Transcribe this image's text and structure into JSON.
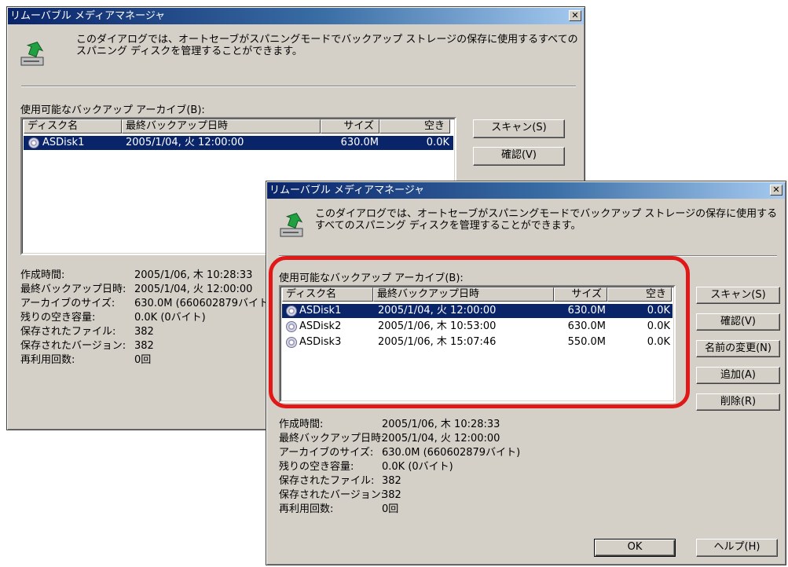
{
  "title": "リムーバブル メディアマネージャ",
  "close_glyph": "✕",
  "description": "このダイアログでは、オートセーブがスパニングモードでバックアップ ストレージの保存に使用するすべてのスパニング ディスクを管理することができます。",
  "archives_label": "使用可能なバックアップ アーカイブ(B):",
  "columns": [
    "ディスク名",
    "最終バックアップ日時",
    "サイズ",
    "空き"
  ],
  "back_rows": [
    {
      "name": "ASDisk1",
      "date": "2005/1/04, 火 12:00:00",
      "size": "630.0M",
      "free": "0.0K",
      "selected": true
    }
  ],
  "rows": [
    {
      "name": "ASDisk1",
      "date": "2005/1/04, 火 12:00:00",
      "size": "630.0M",
      "free": "0.0K",
      "selected": true
    },
    {
      "name": "ASDisk2",
      "date": "2005/1/06, 木 10:53:00",
      "size": "630.0M",
      "free": "0.0K",
      "selected": false
    },
    {
      "name": "ASDisk3",
      "date": "2005/1/06, 木 15:07:46",
      "size": "550.0M",
      "free": "0.0K",
      "selected": false
    }
  ],
  "buttons": {
    "scan": "スキャン(S)",
    "verify": "確認(V)",
    "rename": "名前の変更(N)",
    "add": "追加(A)",
    "delete": "削除(R)",
    "ok": "OK",
    "help": "ヘルプ(H)"
  },
  "info": [
    {
      "label": "作成時間:",
      "value": "2005/1/06, 木 10:28:33"
    },
    {
      "label": "最終バックアップ日時:",
      "value": "2005/1/04, 火 12:00:00"
    },
    {
      "label": "アーカイブのサイズ:",
      "value": "630.0M (660602879バイト)"
    },
    {
      "label": "残りの空き容量:",
      "value": "0.0K (0バイト)"
    },
    {
      "label": "保存されたファイル:",
      "value": "382"
    },
    {
      "label": "保存されたバージョン:",
      "value": "382"
    },
    {
      "label": "再利用回数:",
      "value": "0回"
    }
  ],
  "back_info": [
    {
      "label": "作成時間:",
      "value": "2005/1/06, 木 10:28:33"
    },
    {
      "label": "最終バックアップ日時:",
      "value": "2005/1/04, 火 12:00:00"
    },
    {
      "label": "アーカイブのサイズ:",
      "value": "630.0M (660602879バイト"
    },
    {
      "label": "残りの空き容量:",
      "value": "0.0K (0バイト)"
    },
    {
      "label": "保存されたファイル:",
      "value": "382"
    },
    {
      "label": "保存されたバージョン:",
      "value": "382"
    },
    {
      "label": "再利用回数:",
      "value": "0回"
    }
  ],
  "colors": {
    "highlight": "#e01818",
    "selection": "#0a246a",
    "dialog_face": "#d4d0c8"
  }
}
